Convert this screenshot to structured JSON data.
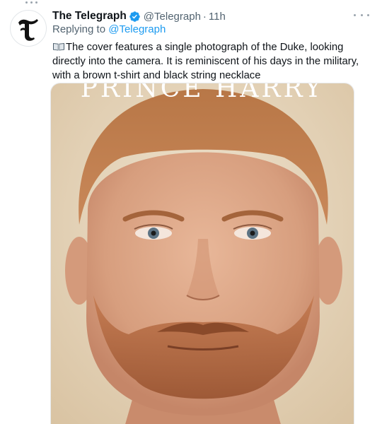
{
  "tweet": {
    "author_name": "The Telegraph",
    "author_handle": "@Telegraph",
    "separator": "·",
    "time_ago": "11h",
    "replying_prefix": "Replying to",
    "replying_handle": "@Telegraph",
    "text": "The cover features a single photograph of the Duke, looking directly into the camera. It is reminiscent of his days in the military, with a brown t-shirt and black string necklace",
    "leading_icon": "open-book-icon"
  },
  "media": {
    "cover_title": "PRINCE HARRY",
    "subject": "portrait photograph"
  },
  "colors": {
    "text_primary": "#0f1419",
    "text_secondary": "#536471",
    "link": "#1d9bf0",
    "verified": "#1d9bf0"
  },
  "icons": [
    "telegraph-logo-icon",
    "verified-badge-icon",
    "more-options-icon",
    "open-book-icon",
    "thread-connector-icon"
  ]
}
